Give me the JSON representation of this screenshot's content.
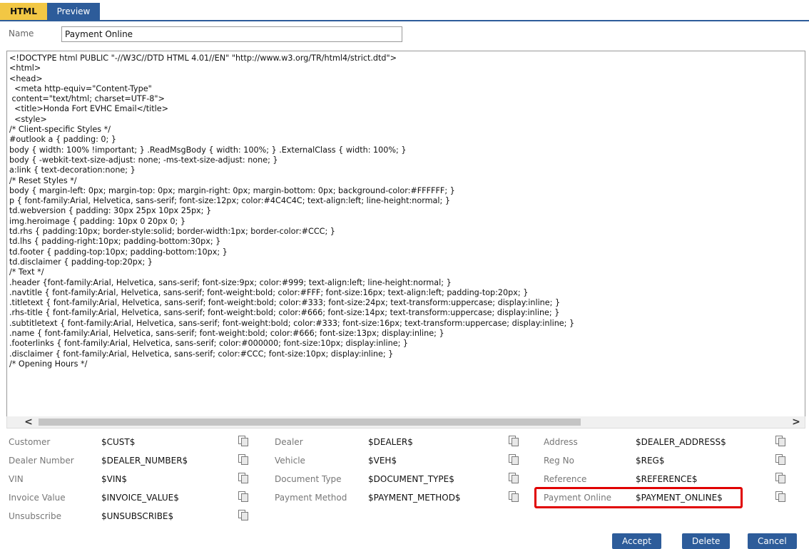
{
  "tabs": [
    {
      "label": "HTML",
      "active": true
    },
    {
      "label": "Preview",
      "active": false
    }
  ],
  "name_field": {
    "label": "Name",
    "value": "Payment Online"
  },
  "editor": {
    "lines": [
      "<!DOCTYPE html PUBLIC \"-//W3C//DTD HTML 4.01//EN\" \"http://www.w3.org/TR/html4/strict.dtd\">",
      "<html>",
      "<head>",
      "  <meta http-equiv=\"Content-Type\"",
      " content=\"text/html; charset=UTF-8\">",
      "  <title>Honda Fort EVHC Email</title>",
      "  <style>",
      "/* Client-specific Styles */",
      "#outlook a { padding: 0; }",
      "body { width: 100% !important; } .ReadMsgBody { width: 100%; } .ExternalClass { width: 100%; }",
      "body { -webkit-text-size-adjust: none; -ms-text-size-adjust: none; }",
      "a:link { text-decoration:none; }",
      "/* Reset Styles */",
      "body { margin-left: 0px; margin-top: 0px; margin-right: 0px; margin-bottom: 0px; background-color:#FFFFFF; }",
      "p { font-family:Arial, Helvetica, sans-serif; font-size:12px; color:#4C4C4C; text-align:left; line-height:normal; }",
      "td.webversion { padding: 30px 25px 10px 25px; }",
      "img.heroimage { padding: 10px 0 20px 0; }",
      "td.rhs { padding:10px; border-style:solid; border-width:1px; border-color:#CCC; }",
      "td.lhs { padding-right:10px; padding-bottom:30px; }",
      "td.footer { padding-top:10px; padding-bottom:10px; }",
      "td.disclaimer { padding-top:20px; }",
      "/* Text */",
      ".header {font-family:Arial, Helvetica, sans-serif; font-size:9px; color:#999; text-align:left; line-height:normal; }",
      ".navtitle { font-family:Arial, Helvetica, sans-serif; font-weight:bold; color:#FFF; font-size:16px; text-align:left; padding-top:20px; }",
      ".titletext { font-family:Arial, Helvetica, sans-serif; font-weight:bold; color:#333; font-size:24px; text-transform:uppercase; display:inline; }",
      ".rhs-title { font-family:Arial, Helvetica, sans-serif; font-weight:bold; color:#666; font-size:14px; text-transform:uppercase; display:inline; }",
      ".subtitletext { font-family:Arial, Helvetica, sans-serif; font-weight:bold; color:#333; font-size:16px; text-transform:uppercase; display:inline; }",
      ".name { font-family:Arial, Helvetica, sans-serif; font-weight:bold; color:#666; font-size:13px; display:inline; }",
      ".footerlinks { font-family:Arial, Helvetica, sans-serif; color:#000000; font-size:10px; display:inline; }",
      ".disclaimer { font-family:Arial, Helvetica, sans-serif; color:#CCC; font-size:10px; display:inline; }",
      "/* Opening Hours */"
    ]
  },
  "scroll": {
    "left_arrow": "<",
    "right_arrow": ">"
  },
  "fields": [
    {
      "label": "Customer",
      "value": "$CUST$",
      "icon": "copy-icon"
    },
    {
      "label": "Dealer",
      "value": "$DEALER$",
      "icon": "copy-icon"
    },
    {
      "label": "Address",
      "value": "$DEALER_ADDRESS$",
      "icon": "copy-icon"
    },
    {
      "label": "Dealer Number",
      "value": "$DEALER_NUMBER$",
      "icon": "copy-icon"
    },
    {
      "label": "Vehicle",
      "value": "$VEH$",
      "icon": "copy-icon"
    },
    {
      "label": "Reg No",
      "value": "$REG$",
      "icon": "copy-icon"
    },
    {
      "label": "VIN",
      "value": "$VIN$",
      "icon": "copy-icon"
    },
    {
      "label": "Document Type",
      "value": "$DOCUMENT_TYPE$",
      "icon": "copy-icon"
    },
    {
      "label": "Reference",
      "value": "$REFERENCE$",
      "icon": "copy-icon"
    },
    {
      "label": "Invoice Value",
      "value": "$INVOICE_VALUE$",
      "icon": "copy-icon"
    },
    {
      "label": "Payment Method",
      "value": "$PAYMENT_METHOD$",
      "icon": "copy-icon"
    },
    {
      "label": "Payment Online",
      "value": "$PAYMENT_ONLINE$",
      "icon": "copy-icon",
      "highlighted": true
    },
    {
      "label": "Unsubscribe",
      "value": "$UNSUBSCRIBE$",
      "icon": "copy-icon"
    }
  ],
  "buttons": [
    "Accept",
    "Delete",
    "Cancel"
  ],
  "colors": {
    "tab_active": "#f2c744",
    "brand_blue": "#2d5c9a",
    "highlight": "#e00000"
  }
}
